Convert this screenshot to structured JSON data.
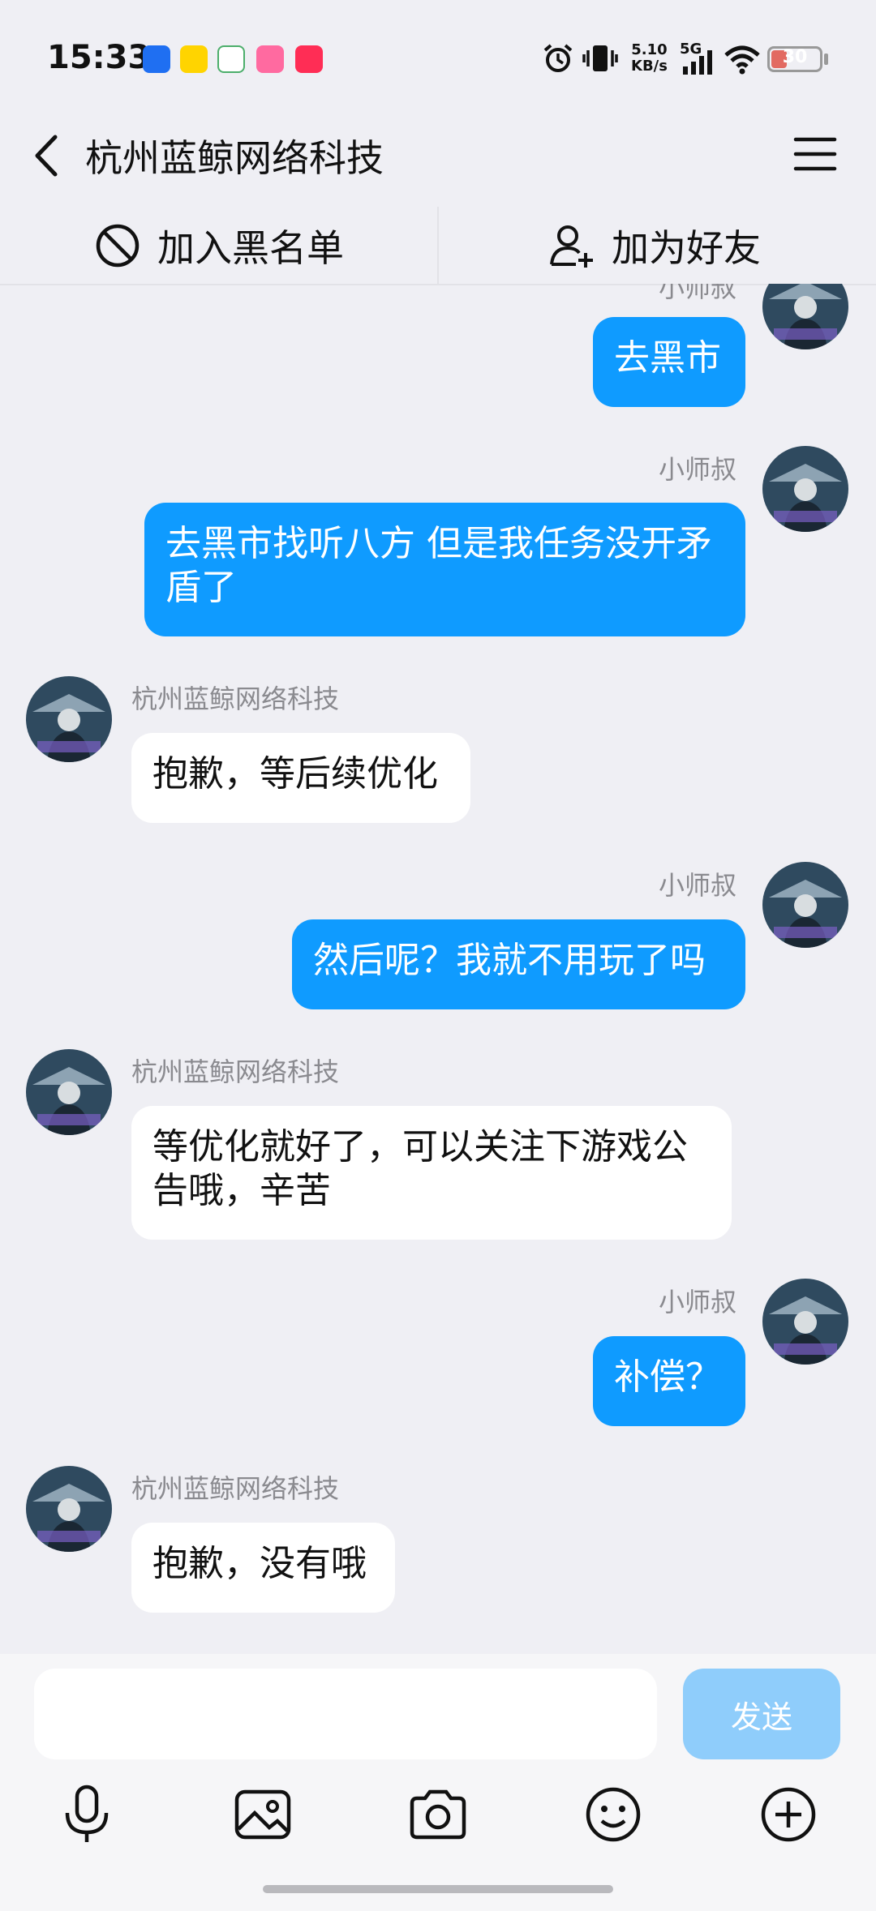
{
  "status_bar": {
    "time": "15:33",
    "network_speed_value": "5.10",
    "network_speed_unit": "KB/s",
    "signal_label": "5G",
    "battery": "30",
    "battery_level": 0.3,
    "app_icons": [
      "fenxiang-app-icon",
      "yellow-app-icon",
      "green-leaf-app-icon",
      "bilibili-app-icon",
      "red-video-app-icon"
    ],
    "icons": [
      "alarm-icon",
      "vibrate-icon",
      "signal-icon",
      "wifi-icon",
      "battery-icon"
    ]
  },
  "nav": {
    "title": "杭州蓝鲸网络科技",
    "back_icon": "chevron-left-icon",
    "menu_icon": "hamburger-menu-icon"
  },
  "actions": {
    "block_label": "加入黑名单",
    "block_icon": "block-icon",
    "add_friend_label": "加为好友",
    "add_friend_icon": "add-user-icon"
  },
  "messages": [
    {
      "direction": "out",
      "sender": "小师叔",
      "text": "去黑市"
    },
    {
      "direction": "out",
      "sender": "小师叔",
      "text": "去黑市找听八方  但是我任务没开矛盾了"
    },
    {
      "direction": "in",
      "sender": "杭州蓝鲸网络科技",
      "text": "抱歉，等后续优化"
    },
    {
      "direction": "out",
      "sender": "小师叔",
      "text": "然后呢？我就不用玩了吗"
    },
    {
      "direction": "in",
      "sender": "杭州蓝鲸网络科技",
      "text": "等优化就好了，可以关注下游戏公告哦，辛苦"
    },
    {
      "direction": "out",
      "sender": "小师叔",
      "text": "补偿？"
    },
    {
      "direction": "in",
      "sender": "杭州蓝鲸网络科技",
      "text": "抱歉，没有哦"
    }
  ],
  "input": {
    "value": "",
    "placeholder": "",
    "send_label": "发送"
  },
  "toolbar": {
    "icons": [
      "microphone-icon",
      "image-icon",
      "camera-icon",
      "emoji-icon",
      "plus-icon"
    ]
  },
  "colors": {
    "outgoing_bubble": "#0f9bff",
    "incoming_bubble": "#ffffff",
    "background": "#efeff4",
    "send_button": "#8fcdfb"
  }
}
